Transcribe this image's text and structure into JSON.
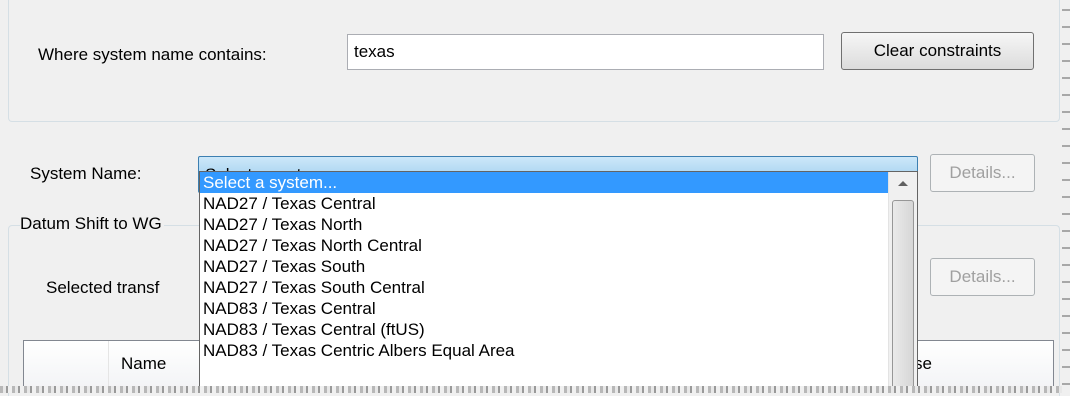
{
  "constraints": {
    "label": "Where system name contains:",
    "value": "texas",
    "clear_button": "Clear constraints"
  },
  "system": {
    "label": "System Name:",
    "selected": "Select a system...",
    "details_button": "Details..."
  },
  "dropdown": {
    "items": [
      "Select a system...",
      "NAD27 / Texas Central",
      "NAD27 / Texas North",
      "NAD27 / Texas North Central",
      "NAD27 / Texas South",
      "NAD27 / Texas South Central",
      "NAD83 / Texas Central",
      "NAD83 / Texas Central (ftUS)",
      "NAD83 / Texas Centric Albers Equal Area"
    ],
    "selected_index": 0
  },
  "datum": {
    "label": "Datum Shift to WG",
    "selected_label": "Selected transf",
    "details_button": "Details..."
  },
  "table": {
    "columns": [
      "Name",
      "se"
    ]
  }
}
